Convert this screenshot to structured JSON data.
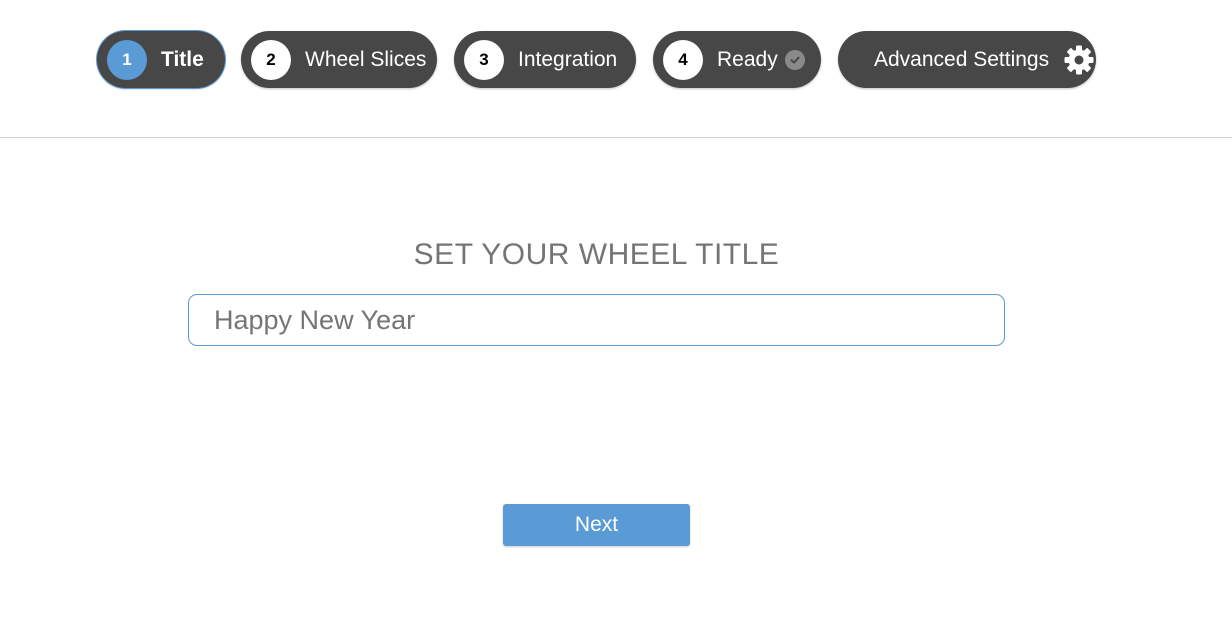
{
  "steps": [
    {
      "number": "1",
      "label": "Title",
      "active": true
    },
    {
      "number": "2",
      "label": "Wheel Slices"
    },
    {
      "number": "3",
      "label": "Integration"
    },
    {
      "number": "4",
      "label": "Ready",
      "icon": "check-circle-icon"
    }
  ],
  "advanced_settings": {
    "label": "Advanced Settings",
    "icon": "gear-icon"
  },
  "main": {
    "heading": "SET YOUR WHEEL TITLE",
    "title_input_value": "Happy New Year",
    "next_label": "Next"
  },
  "colors": {
    "accent": "#5b9bd5",
    "pill_background": "#474747",
    "heading_text": "#757575"
  }
}
